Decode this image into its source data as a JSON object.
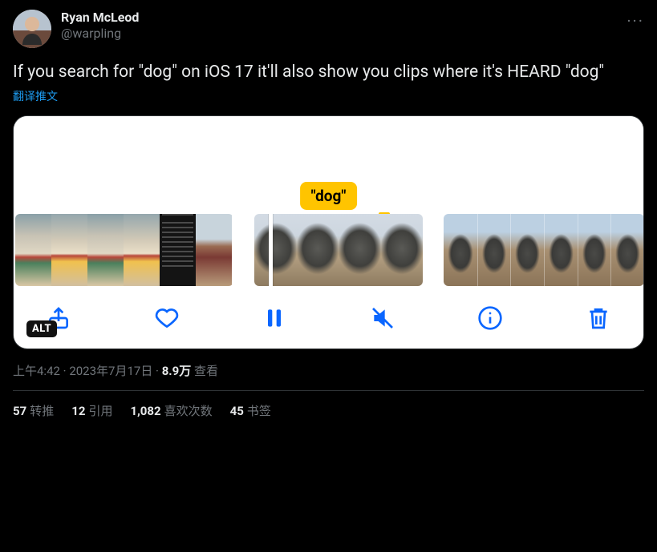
{
  "author": {
    "display_name": "Ryan McLeod",
    "handle": "@warpling"
  },
  "tweet_text": "If you search for \"dog\" on iOS 17 it'll also show you clips where it's HEARD \"dog\"",
  "translate_label": "翻译推文",
  "media": {
    "caption_text": "\"dog\"",
    "alt_badge": "ALT",
    "toolbar": {
      "share": "share",
      "like": "like",
      "pause": "pause",
      "mute": "mute",
      "info": "info",
      "trash": "trash"
    }
  },
  "meta": {
    "time": "上午4:42",
    "date": "2023年7月17日",
    "separator": " · ",
    "views_count": "8.9万",
    "views_label": " 查看"
  },
  "stats": {
    "retweets_count": "57",
    "retweets_label": "转推",
    "quotes_count": "12",
    "quotes_label": "引用",
    "likes_count": "1,082",
    "likes_label": "喜欢次数",
    "bookmarks_count": "45",
    "bookmarks_label": "书签"
  },
  "more_label": "···"
}
